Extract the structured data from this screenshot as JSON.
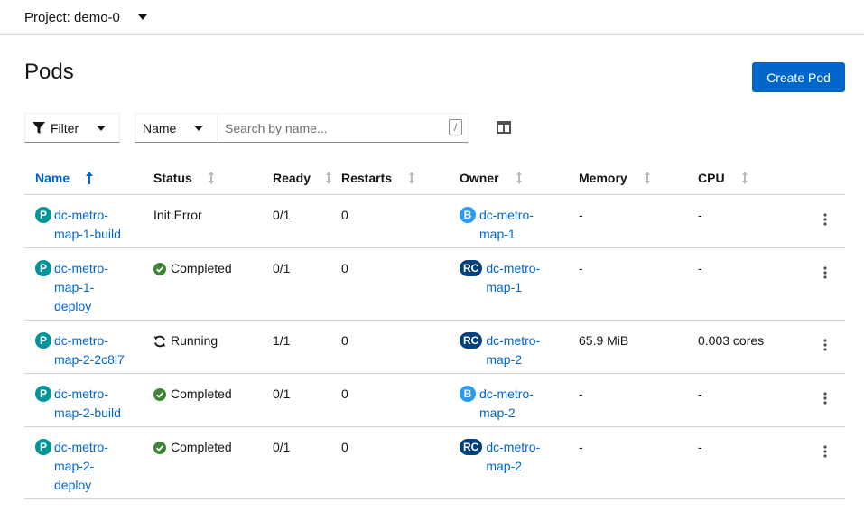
{
  "project": {
    "label": "Project: demo-0"
  },
  "page": {
    "title": "Pods",
    "create_label": "Create Pod"
  },
  "toolbar": {
    "filter_label": "Filter",
    "name_select": "Name",
    "search_placeholder": "Search by name...",
    "search_shortcut": "/"
  },
  "columns": [
    "Name",
    "Status",
    "Ready",
    "Restarts",
    "Owner",
    "Memory",
    "CPU"
  ],
  "colors": {
    "accent": "#0066cc",
    "pod_badge": "#009596",
    "build_badge": "#2b9af3",
    "rc_badge": "#004080",
    "success": "#3e8635"
  },
  "rows": [
    {
      "badge": "P",
      "name_lines": [
        "dc-metro-",
        "map-1-build"
      ],
      "status": "Init:Error",
      "status_icon": "none",
      "ready": "0/1",
      "restarts": "0",
      "owner_badge": "B",
      "owner_lines": [
        "dc-metro-",
        "map-1"
      ],
      "memory": "-",
      "cpu": "-"
    },
    {
      "badge": "P",
      "name_lines": [
        "dc-metro-",
        "map-1-",
        "deploy"
      ],
      "status": "Completed",
      "status_icon": "check-circle-icon",
      "ready": "0/1",
      "restarts": "0",
      "owner_badge": "RC",
      "owner_lines": [
        "dc-metro-",
        "map-1"
      ],
      "memory": "-",
      "cpu": "-"
    },
    {
      "badge": "P",
      "name_lines": [
        "dc-metro-",
        "map-2-2c8l7"
      ],
      "status": "Running",
      "status_icon": "sync-icon",
      "ready": "1/1",
      "restarts": "0",
      "owner_badge": "RC",
      "owner_lines": [
        "dc-metro-",
        "map-2"
      ],
      "memory": "65.9 MiB",
      "cpu": "0.003 cores"
    },
    {
      "badge": "P",
      "name_lines": [
        "dc-metro-",
        "map-2-build"
      ],
      "status": "Completed",
      "status_icon": "check-circle-icon",
      "ready": "0/1",
      "restarts": "0",
      "owner_badge": "B",
      "owner_lines": [
        "dc-metro-",
        "map-2"
      ],
      "memory": "-",
      "cpu": "-"
    },
    {
      "badge": "P",
      "name_lines": [
        "dc-metro-",
        "map-2-",
        "deploy"
      ],
      "status": "Completed",
      "status_icon": "check-circle-icon",
      "ready": "0/1",
      "restarts": "0",
      "owner_badge": "RC",
      "owner_lines": [
        "dc-metro-",
        "map-2"
      ],
      "memory": "-",
      "cpu": "-"
    }
  ]
}
